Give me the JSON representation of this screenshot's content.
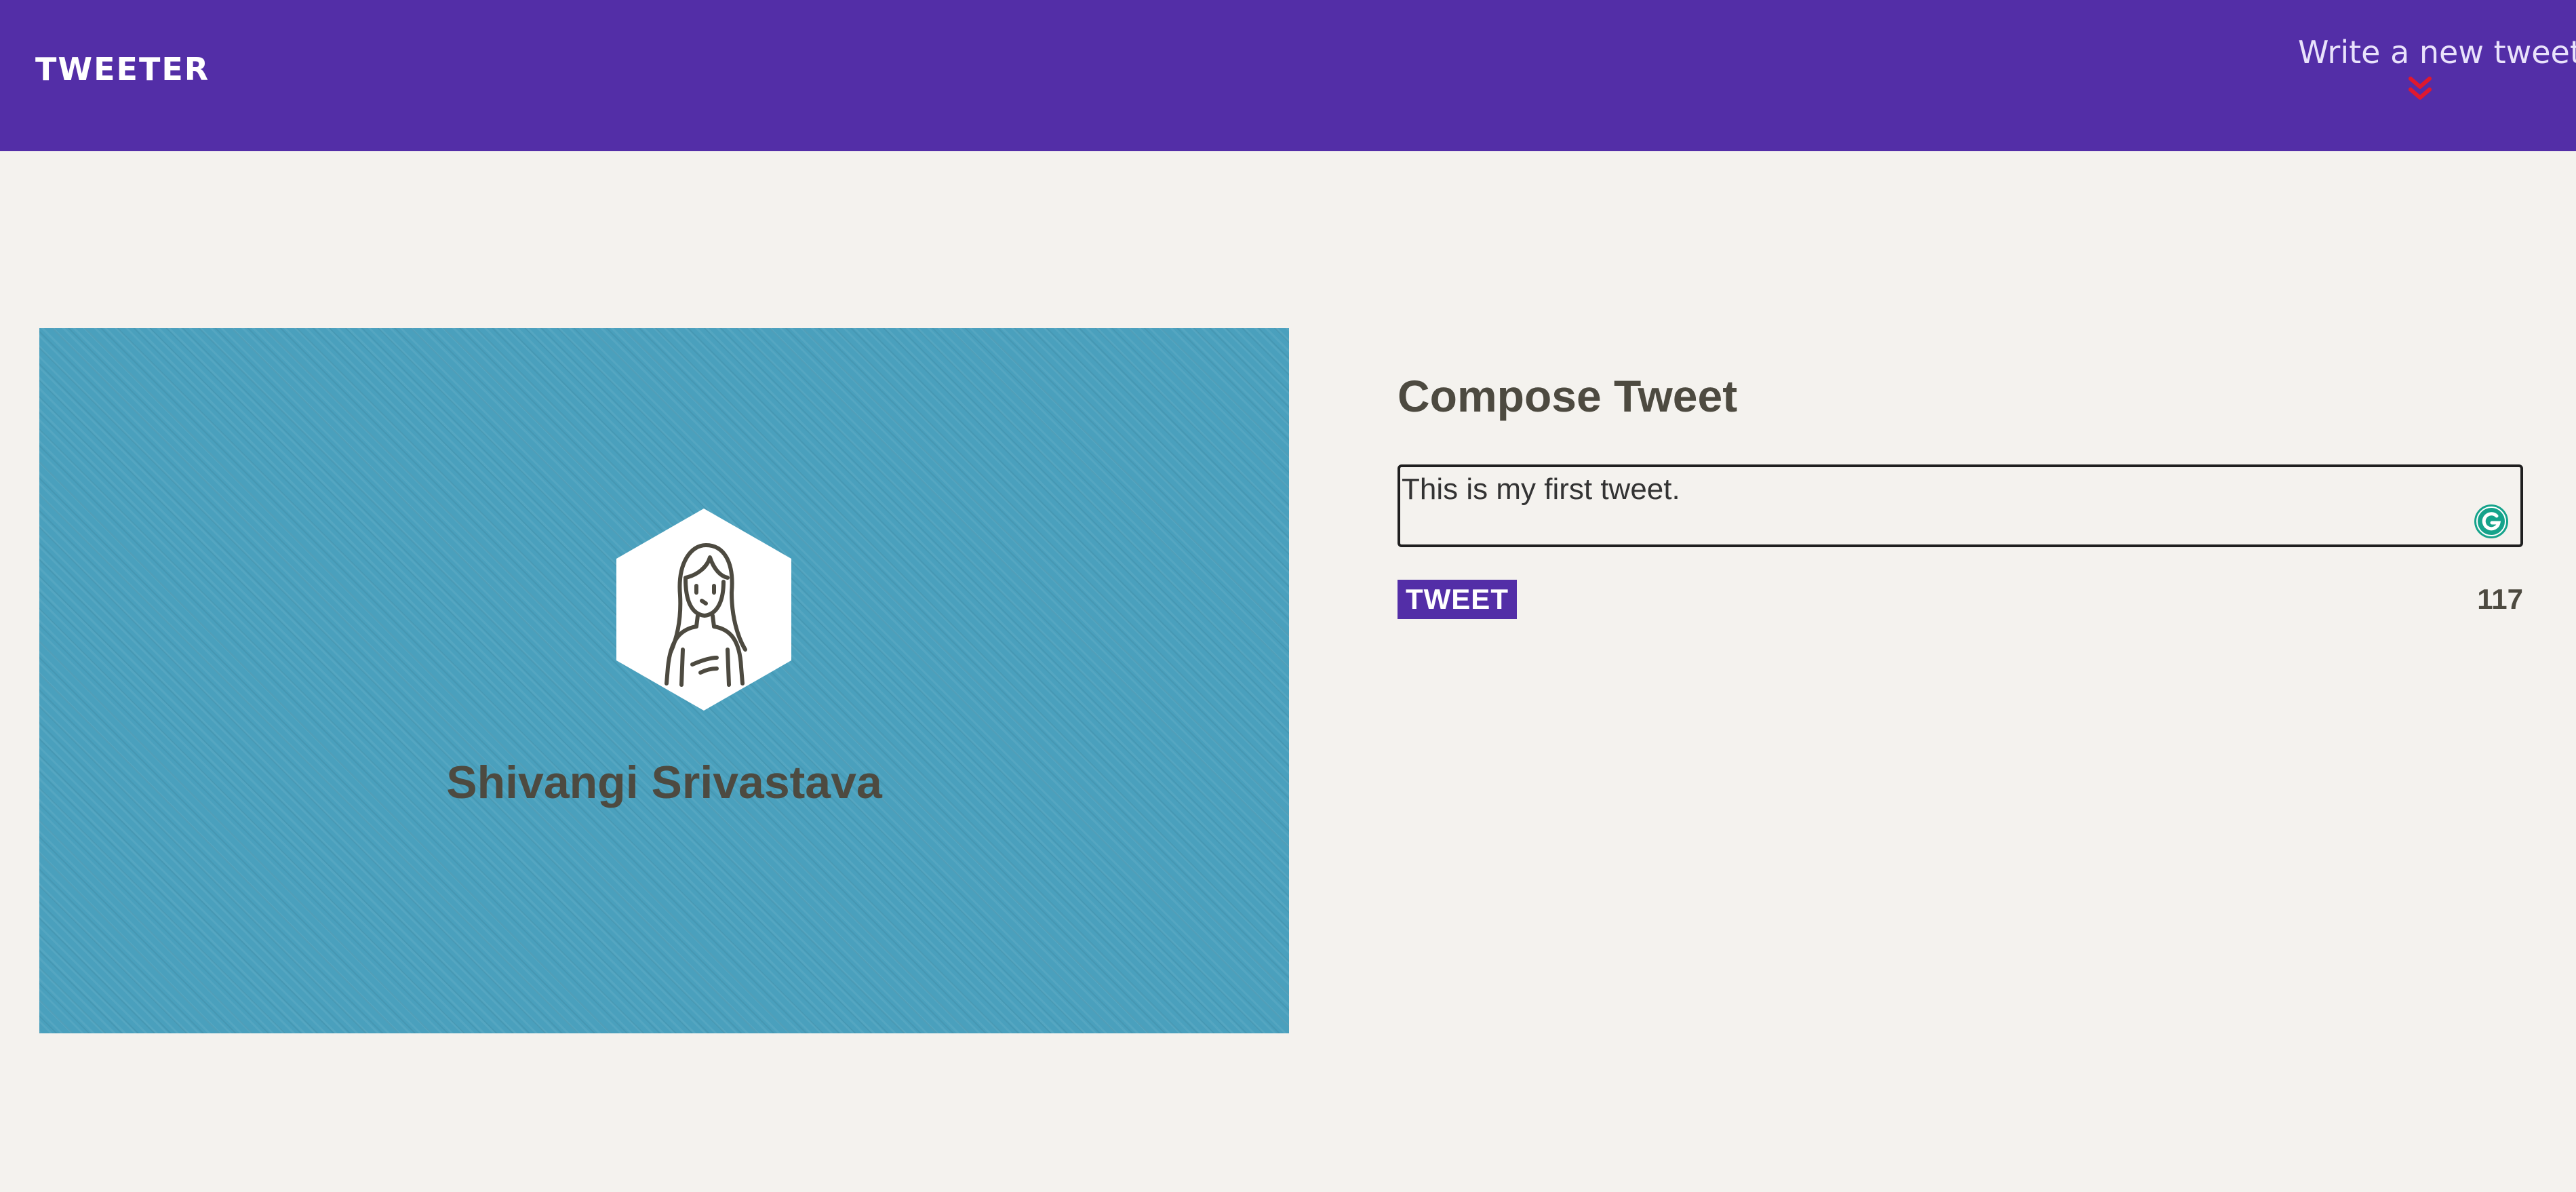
{
  "nav": {
    "brand": "TWEETER",
    "compose_toggle_label": "Write a new tweet",
    "toggle_icon": "double-chevron-down",
    "background_color": "#532ea7",
    "toggle_icon_color": "#e0182f"
  },
  "profile": {
    "name": "Shivangi Srivastava",
    "avatar_icon": "woman-avatar",
    "card_color": "#4aa0bd"
  },
  "compose": {
    "title": "Compose Tweet",
    "input_value": "This is my first tweet.",
    "submit_label": "TWEET",
    "char_count": "117",
    "extension_icon": "grammarly-icon"
  },
  "page": {
    "background_color": "#f4f2ee"
  }
}
